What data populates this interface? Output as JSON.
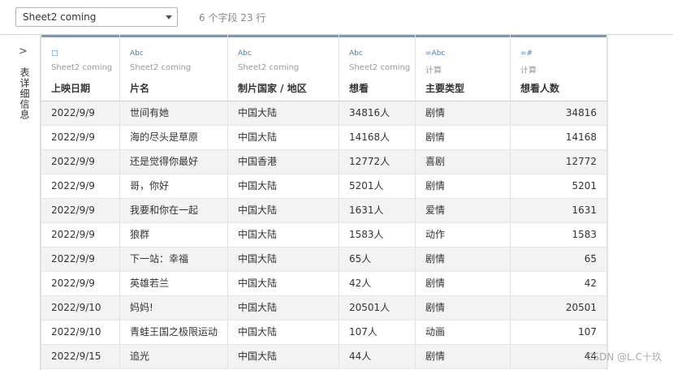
{
  "toolbar": {
    "source_select": "Sheet2 coming",
    "field_count": "6 个字段 23 行"
  },
  "side_panel": {
    "chevron": ">",
    "label": "表详细信息"
  },
  "columns": [
    {
      "icon": "calendar-icon",
      "icon_glyph": "□",
      "source": "Sheet2 coming",
      "name": "上映日期"
    },
    {
      "icon": "string-icon",
      "icon_glyph": "Abc",
      "source": "Sheet2 coming",
      "name": "片名"
    },
    {
      "icon": "string-icon",
      "icon_glyph": "Abc",
      "source": "Sheet2 coming",
      "name": "制片国家 / 地区"
    },
    {
      "icon": "string-icon",
      "icon_glyph": "Abc",
      "source": "Sheet2 coming",
      "name": "想看"
    },
    {
      "icon": "calc-string-icon",
      "icon_glyph": "=Abc",
      "source": "计算",
      "name": "主要类型"
    },
    {
      "icon": "calc-number-icon",
      "icon_glyph": "=#",
      "source": "计算",
      "name": "想看人数"
    }
  ],
  "rows": [
    [
      "2022/9/9",
      "世间有她",
      "中国大陆",
      "34816人",
      "剧情",
      "34816"
    ],
    [
      "2022/9/9",
      "海的尽头是草原",
      "中国大陆",
      "14168人",
      "剧情",
      "14168"
    ],
    [
      "2022/9/9",
      "还是觉得你最好",
      "中国香港",
      "12772人",
      "喜剧",
      "12772"
    ],
    [
      "2022/9/9",
      "哥，你好",
      "中国大陆",
      "5201人",
      "剧情",
      "5201"
    ],
    [
      "2022/9/9",
      "我要和你在一起",
      "中国大陆",
      "1631人",
      "爱情",
      "1631"
    ],
    [
      "2022/9/9",
      "狼群",
      "中国大陆",
      "1583人",
      "动作",
      "1583"
    ],
    [
      "2022/9/9",
      "下一站：幸福",
      "中国大陆",
      "65人",
      "剧情",
      "65"
    ],
    [
      "2022/9/9",
      "英雄若兰",
      "中国大陆",
      "42人",
      "剧情",
      "42"
    ],
    [
      "2022/9/10",
      "妈妈!",
      "中国大陆",
      "20501人",
      "剧情",
      "20501"
    ],
    [
      "2022/9/10",
      "青蛙王国之极限运动",
      "中国大陆",
      "107人",
      "动画",
      "107"
    ],
    [
      "2022/9/15",
      "追光",
      "中国大陆",
      "44人",
      "剧情",
      "44"
    ]
  ],
  "watermark": "CSDN @L.C十玖"
}
